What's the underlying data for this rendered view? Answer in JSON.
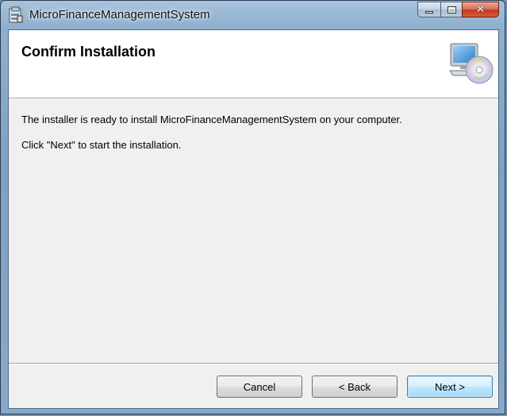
{
  "window": {
    "title": "MicroFinanceManagementSystem",
    "minimize_glyph": "",
    "maximize_glyph": "",
    "close_glyph": "✕"
  },
  "banner": {
    "title": "Confirm Installation",
    "icon": "computer-cd-icon"
  },
  "body": {
    "line1": "The installer is ready to install MicroFinanceManagementSystem on your computer.",
    "line2": "Click \"Next\" to start the installation."
  },
  "buttons": {
    "cancel": "Cancel",
    "back": "< Back",
    "next": "Next >"
  },
  "colors": {
    "client_background": "#f0f0f0",
    "banner_background": "#ffffff",
    "default_button_border": "#3c7fb1",
    "close_button": "#c4391f"
  }
}
